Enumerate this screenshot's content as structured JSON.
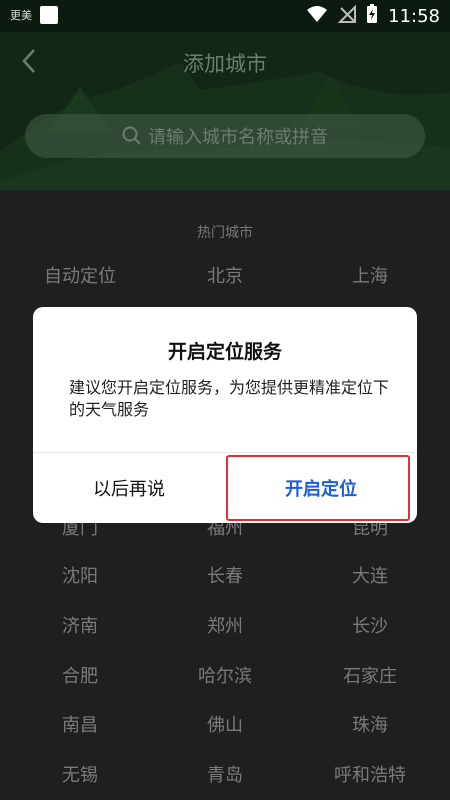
{
  "status_bar": {
    "left_text": "更美",
    "time": "11:58"
  },
  "header": {
    "title": "添加城市",
    "search_placeholder": "请输入城市名称或拼音"
  },
  "hot_cities": {
    "title": "热门城市",
    "rows": [
      [
        "自动定位",
        "北京",
        "上海"
      ],
      [
        "厦门",
        "福州",
        "昆明"
      ],
      [
        "沈阳",
        "长春",
        "大连"
      ],
      [
        "济南",
        "郑州",
        "长沙"
      ],
      [
        "合肥",
        "哈尔滨",
        "石家庄"
      ],
      [
        "南昌",
        "佛山",
        "珠海"
      ],
      [
        "无锡",
        "青岛",
        "呼和浩特"
      ]
    ]
  },
  "dialog": {
    "title": "开启定位服务",
    "message": "建议您开启定位服务，为您提供更精准定位下的天气服务",
    "later_label": "以后再说",
    "enable_label": "开启定位"
  },
  "colors": {
    "accent": "#1a5fd8",
    "highlight": "#e03030"
  }
}
